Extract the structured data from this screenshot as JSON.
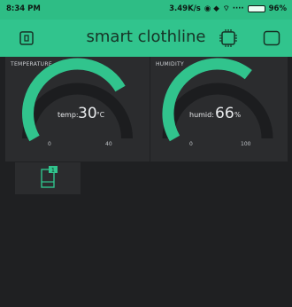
{
  "status_bar": {
    "time": "8:34 PM",
    "net_speed": "3.49K/s",
    "battery": "96%"
  },
  "app": {
    "title": "smart clothline",
    "accent": "#31c48d"
  },
  "widgets": {
    "temperature": {
      "label": "TEMPERATURE",
      "prefix": "temp:",
      "value": "30",
      "unit": "°C",
      "min": "0",
      "max": "40",
      "fraction": 0.75
    },
    "humidity": {
      "label": "HUMIDITY",
      "prefix": "humid:",
      "value": "66",
      "unit": "%",
      "min": "0",
      "max": "100",
      "fraction": 0.66
    }
  },
  "tile": {
    "badge": "1",
    "icon": "device-icon"
  }
}
